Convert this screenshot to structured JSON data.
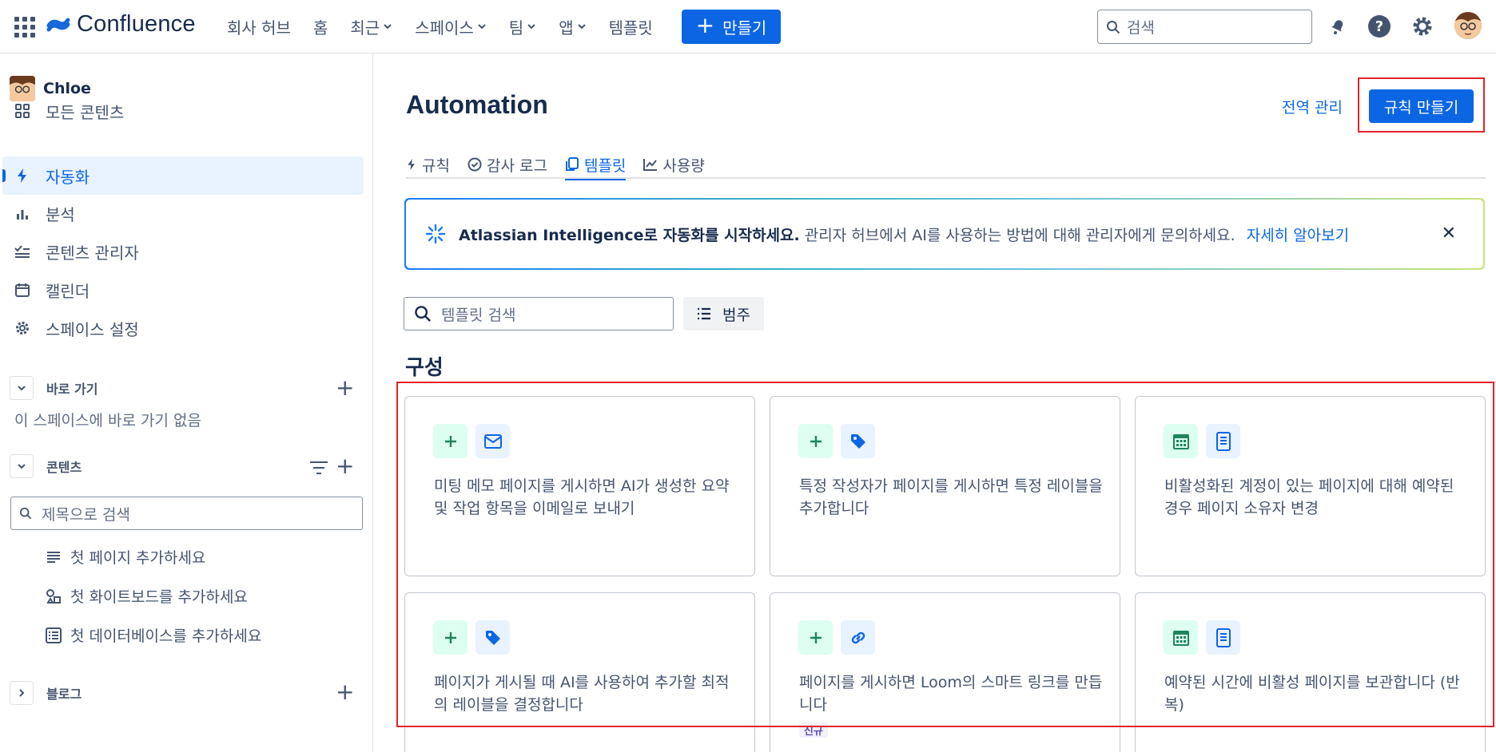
{
  "app": {
    "name": "Confluence"
  },
  "topnav": {
    "items": [
      {
        "label": "회사 허브",
        "has_menu": false
      },
      {
        "label": "홈",
        "has_menu": false
      },
      {
        "label": "최근",
        "has_menu": true
      },
      {
        "label": "스페이스",
        "has_menu": true
      },
      {
        "label": "팀",
        "has_menu": true
      },
      {
        "label": "앱",
        "has_menu": true
      },
      {
        "label": "템플릿",
        "has_menu": false
      }
    ],
    "create_label": "만들기",
    "search_placeholder": "검색"
  },
  "sidebar": {
    "user": "Chloe",
    "items": [
      {
        "label": "모든 콘텐츠",
        "icon": "grid-icon"
      },
      {
        "label": "자동화",
        "icon": "lightning-icon",
        "active": true
      },
      {
        "label": "분석",
        "icon": "bar-chart-icon"
      },
      {
        "label": "콘텐츠 관리자",
        "icon": "checklist-icon"
      },
      {
        "label": "캘린더",
        "icon": "calendar-icon"
      },
      {
        "label": "스페이스 설정",
        "icon": "gear-icon"
      }
    ],
    "shortcuts": {
      "label": "바로 가기",
      "empty_text": "이 스페이스에 바로 가기 없음"
    },
    "content": {
      "label": "콘텐츠",
      "search_placeholder": "제목으로 검색",
      "children": [
        {
          "label": "첫 페이지 추가하세요",
          "icon": "page-icon"
        },
        {
          "label": "첫 화이트보드를 추가하세요",
          "icon": "whiteboard-icon"
        },
        {
          "label": "첫 데이터베이스를 추가하세요",
          "icon": "database-icon"
        }
      ]
    },
    "blog": {
      "label": "블로그"
    }
  },
  "main": {
    "title": "Automation",
    "global_manage_label": "전역 관리",
    "create_rule_label": "규칙 만들기",
    "tabs": [
      {
        "label": "규칙",
        "icon": "lightning-icon"
      },
      {
        "label": "감사 로그",
        "icon": "check-circle-icon"
      },
      {
        "label": "템플릿",
        "icon": "copy-icon",
        "active": true
      },
      {
        "label": "사용량",
        "icon": "line-chart-icon"
      }
    ],
    "banner": {
      "bold": "Atlassian Intelligence로 자동화를 시작하세요.",
      "text": "관리자 허브에서 AI를 사용하는 방법에 대해 관리자에게 문의하세요.",
      "link": "자세히 알아보기"
    },
    "template_search_placeholder": "템플릿 검색",
    "category_label": "범주",
    "section_title": "구성",
    "cards": [
      {
        "icons": [
          "plus-icon",
          "mail-icon"
        ],
        "text": "미팅 메모 페이지를 게시하면 AI가 생성한 요약 및 작업 항목을 이메일로 보내기"
      },
      {
        "icons": [
          "plus-icon",
          "tag-icon"
        ],
        "text": "특정 작성자가 페이지를 게시하면 특정 레이블을 추가합니다"
      },
      {
        "icons": [
          "calendar-icon",
          "page-icon"
        ],
        "text": "비활성화된 계정이 있는 페이지에 대해 예약된 경우 페이지 소유자 변경"
      },
      {
        "icons": [
          "plus-icon",
          "tag-icon"
        ],
        "text": "페이지가 게시될 때 AI를 사용하여 추가할 최적의 레이블을 결정합니다"
      },
      {
        "icons": [
          "plus-icon",
          "link-icon"
        ],
        "text": "페이지를 게시하면 Loom의 스마트 링크를 만듭니다",
        "badge": "신규"
      },
      {
        "icons": [
          "calendar-icon",
          "page-icon"
        ],
        "text": "예약된 시간에 비활성 페이지를 보관합니다 (반복)"
      }
    ]
  },
  "colors": {
    "primary": "#0c66e4",
    "highlight": "#e2242c",
    "green_icon": "#1f845a",
    "blue_icon": "#0c66e4"
  }
}
